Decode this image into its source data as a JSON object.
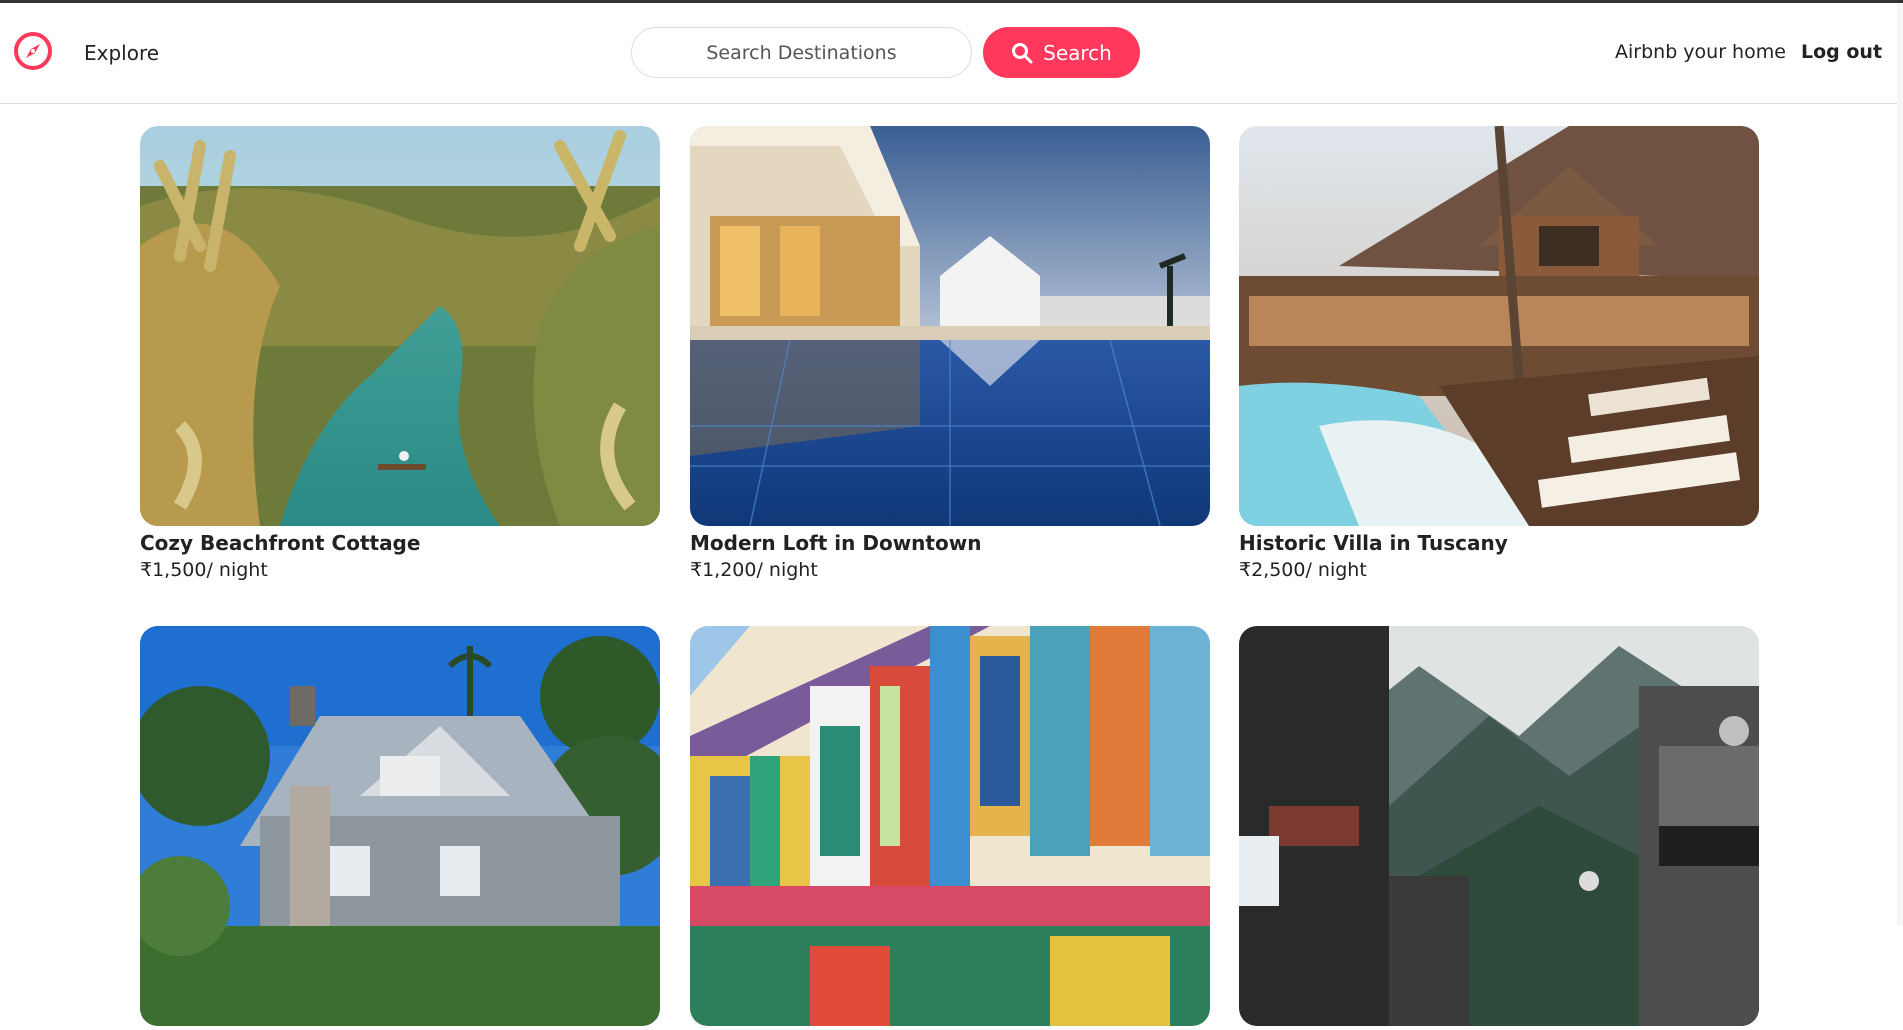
{
  "nav": {
    "explore_label": "Explore",
    "search_placeholder": "Search Destinations",
    "search_button_label": "Search",
    "host_link": "Airbnb your home",
    "logout_label": "Log out",
    "logo_icon": "compass-icon",
    "search_icon": "search-icon"
  },
  "colors": {
    "brand": "#ff385c",
    "text": "#222222",
    "border": "#dddddd"
  },
  "listings": [
    {
      "title": "Cozy Beachfront Cottage",
      "price": "₹1,500/ night",
      "image": "tropical-river-palms"
    },
    {
      "title": "Modern Loft in Downtown",
      "price": "₹1,200/ night",
      "image": "resort-pool-dusk"
    },
    {
      "title": "Historic Villa in Tuscany",
      "price": "₹2,500/ night",
      "image": "wooden-villa-pool"
    },
    {
      "title": "",
      "price": "",
      "image": "grey-house-palms"
    },
    {
      "title": "",
      "price": "",
      "image": "colorful-shuttered-facade"
    },
    {
      "title": "",
      "price": "",
      "image": "mountain-town-street"
    }
  ]
}
